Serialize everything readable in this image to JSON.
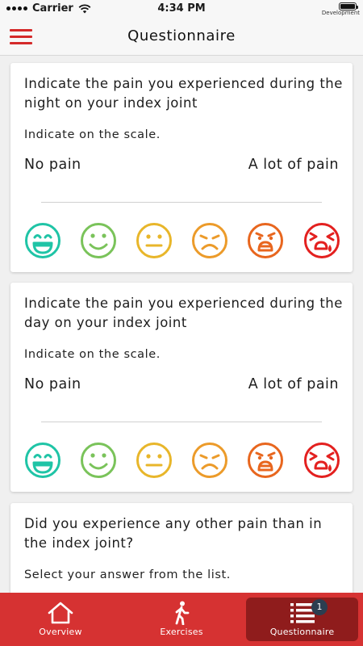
{
  "status_bar": {
    "carrier": "Carrier",
    "time": "4:34 PM",
    "device_label": "Development"
  },
  "nav": {
    "title": "Questionnaire"
  },
  "questions": [
    {
      "title": "Indicate the pain you experienced during the night on your index joint",
      "instruction": "Indicate on the scale.",
      "scale_min": "No pain",
      "scale_max": "A lot of pain",
      "faces": [
        "very-happy",
        "happy",
        "neutral",
        "sad",
        "distressed",
        "crying"
      ]
    },
    {
      "title": "Indicate the pain you experienced during the day on your index joint",
      "instruction": "Indicate on the scale.",
      "scale_min": "No pain",
      "scale_max": "A lot of pain",
      "faces": [
        "very-happy",
        "happy",
        "neutral",
        "sad",
        "distressed",
        "crying"
      ]
    },
    {
      "title": "Did you experience any other pain than in the index joint?",
      "instruction": "Select your answer from the list."
    }
  ],
  "face_colors": [
    "#1fc4a6",
    "#7ac35a",
    "#e8b62a",
    "#ec9b2a",
    "#e8661e",
    "#e3201f"
  ],
  "tabs": [
    {
      "label": "Overview",
      "icon": "home-icon"
    },
    {
      "label": "Exercises",
      "icon": "walking-icon"
    },
    {
      "label": "Questionnaire",
      "icon": "list-icon",
      "badge": "1",
      "active": true
    }
  ],
  "colors": {
    "accent": "#d63232",
    "active_tab": "#8f1c1c",
    "badge": "#2c3e50"
  }
}
